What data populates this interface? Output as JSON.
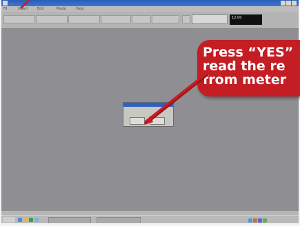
{
  "app": {
    "title": "..."
  },
  "menu": [
    "Fil",
    "Insert",
    "Edit",
    "Mode",
    "Help"
  ],
  "toolbar": {
    "buttons": [
      "",
      "",
      "",
      "",
      "",
      "",
      ""
    ]
  },
  "clock": {
    "line1": "12:00",
    "line2": ""
  },
  "dialog": {
    "title": "",
    "message": "",
    "yes_label": "",
    "no_label": ""
  },
  "status": {
    "left": "",
    "right": ""
  },
  "taskbar": {
    "start_label": "",
    "tasks": [
      "",
      ""
    ],
    "tray_clock": ""
  },
  "callout": {
    "lines": [
      "Press “YES”",
      "read the re",
      "from meter"
    ]
  },
  "colors": {
    "callout": "#c41d24",
    "titlebar": "#2a5fb8",
    "workspace": "#8e8e93"
  }
}
